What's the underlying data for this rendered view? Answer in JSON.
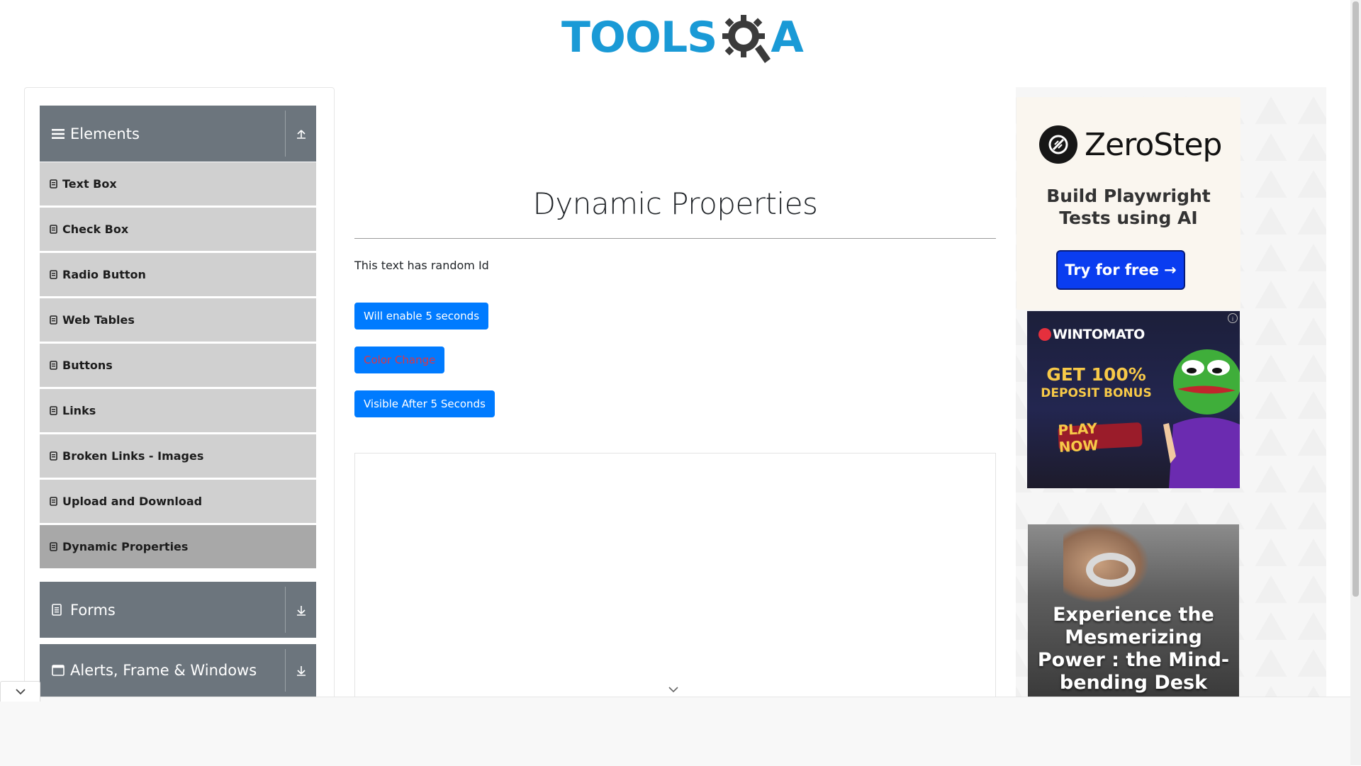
{
  "logo": {
    "part1": "TOOLS",
    "part2": "A"
  },
  "sidebar": {
    "elements_group": {
      "title": "Elements"
    },
    "items": [
      {
        "label": "Text Box"
      },
      {
        "label": "Check Box"
      },
      {
        "label": "Radio Button"
      },
      {
        "label": "Web Tables"
      },
      {
        "label": "Buttons"
      },
      {
        "label": "Links"
      },
      {
        "label": "Broken Links - Images"
      },
      {
        "label": "Upload and Download"
      },
      {
        "label": "Dynamic Properties"
      }
    ],
    "forms_group": {
      "title": "Forms"
    },
    "alerts_group": {
      "title": "Alerts, Frame & Windows"
    }
  },
  "main": {
    "title": "Dynamic Properties",
    "random_text": "This text has random Id",
    "enable_button": "Will enable 5 seconds",
    "color_button": "Color Change",
    "visible_button": "Visible After 5 Seconds"
  },
  "ads": {
    "zerostep": {
      "name": "ZeroStep",
      "tagline_line1": "Build Playwright",
      "tagline_line2": "Tests using AI",
      "cta": "Try for free →"
    },
    "wintomato": {
      "brand": "WINTOMATO",
      "headline": "GET 100%",
      "subheadline": "DEPOSIT BONUS",
      "cta": "PLAY NOW"
    },
    "sculpture": {
      "text": "Experience the Mesmerizing Power : the Mind-bending Desk Sculpture!"
    }
  },
  "colors": {
    "sidebar_header": "#6c757d",
    "menu_item": "#d0d0d0",
    "menu_item_active": "#a8a8a8",
    "primary_button": "#007bff",
    "color_change_text": "#dc3545",
    "logo_blue": "#1a9ad6"
  }
}
